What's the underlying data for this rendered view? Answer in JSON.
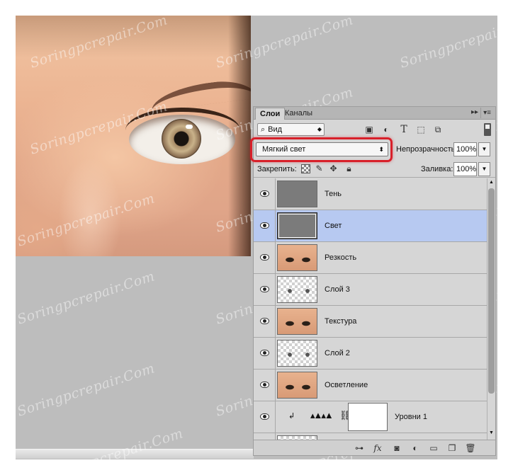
{
  "panel": {
    "tabs": [
      {
        "label": "Слои"
      },
      {
        "label": "Каналы"
      }
    ],
    "collapse_glyph": "▸▸",
    "menu_glyph": "▾≡",
    "filter": {
      "label": "Вид",
      "icons": [
        "image-filter-icon",
        "adjustment-filter-icon",
        "type-filter-icon",
        "shape-filter-icon",
        "smart-object-filter-icon"
      ]
    },
    "blend_mode": "Мягкий свет",
    "opacity_label": "Непрозрачность:",
    "opacity_value": "100%",
    "lock_label": "Закрепить:",
    "fill_label": "Заливка:",
    "fill_value": "100%",
    "highlight_color": "#d8202a",
    "selection_color": "#b7c9f1"
  },
  "layers": [
    {
      "name": "Тень",
      "thumb": "gray",
      "visible": true,
      "selected": false
    },
    {
      "name": "Свет",
      "thumb": "gray",
      "visible": true,
      "selected": true
    },
    {
      "name": "Резкость",
      "thumb": "face",
      "visible": true,
      "selected": false
    },
    {
      "name": "Слой 3",
      "thumb": "checker",
      "visible": true,
      "selected": false
    },
    {
      "name": "Текстура",
      "thumb": "face",
      "visible": true,
      "selected": false
    },
    {
      "name": "Слой 2",
      "thumb": "checker",
      "visible": true,
      "selected": false
    },
    {
      "name": "Осветление",
      "thumb": "face",
      "visible": true,
      "selected": false
    },
    {
      "name": "Уровни 1",
      "thumb": "adjustment",
      "visible": true,
      "selected": false
    }
  ],
  "bottom_bar_icons": [
    "link-layers-icon",
    "fx-icon",
    "add-mask-icon",
    "adjustment-layer-icon",
    "new-group-icon",
    "new-layer-icon",
    "delete-layer-icon"
  ],
  "watermark": "Soringpcrepair.Com"
}
